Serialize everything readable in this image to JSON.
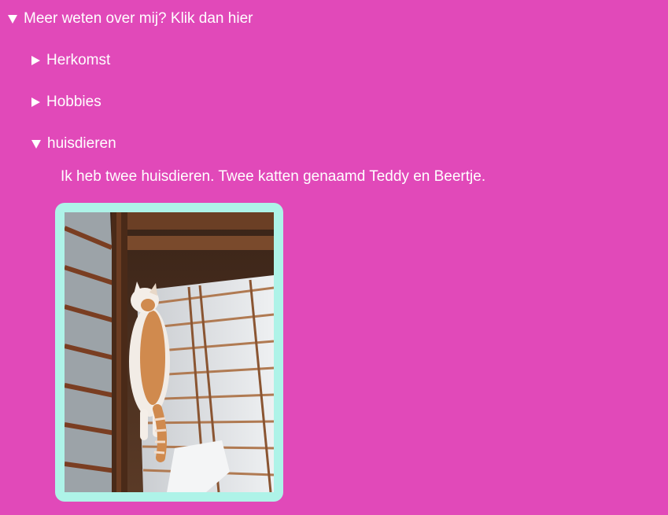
{
  "details": {
    "main_summary": "Meer weten over mij? Klik dan hier",
    "items": [
      {
        "label": "Herkomst",
        "open": false
      },
      {
        "label": "Hobbies",
        "open": false
      },
      {
        "label": "huisdieren",
        "open": true
      }
    ],
    "huisdieren_text": "Ik heb twee huisdieren. Twee katten genaamd Teddy en Beertje."
  },
  "colors": {
    "background": "#e149b9",
    "text": "#ffffff",
    "photo_border": "#aef3e8"
  },
  "photo": {
    "subject": "cat-standing-against-shoji-screen"
  }
}
